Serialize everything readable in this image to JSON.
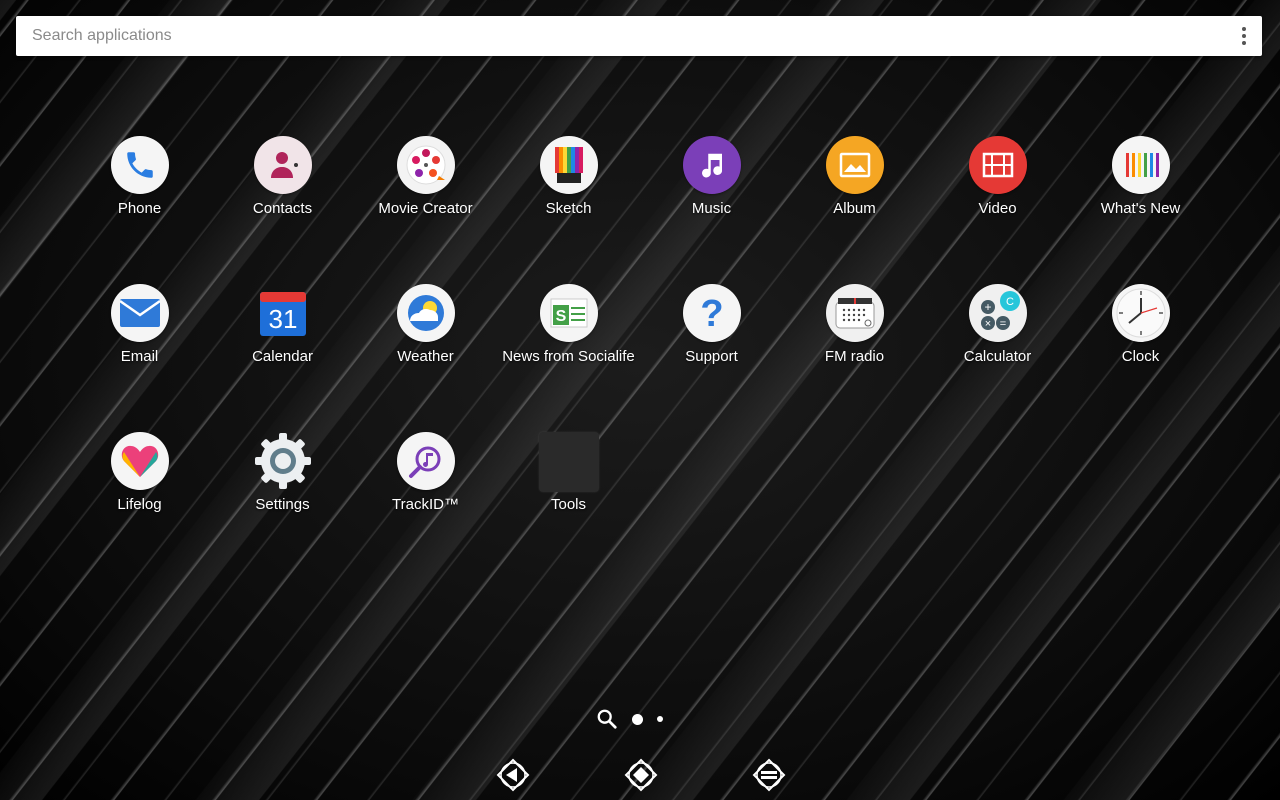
{
  "search": {
    "placeholder": "Search applications"
  },
  "apps": [
    {
      "label": "Phone",
      "icon": "phone-icon"
    },
    {
      "label": "Contacts",
      "icon": "contacts-icon"
    },
    {
      "label": "Movie Creator",
      "icon": "movie-creator-icon"
    },
    {
      "label": "Sketch",
      "icon": "sketch-icon"
    },
    {
      "label": "Music",
      "icon": "music-icon"
    },
    {
      "label": "Album",
      "icon": "album-icon"
    },
    {
      "label": "Video",
      "icon": "video-icon"
    },
    {
      "label": "What's New",
      "icon": "whats-new-icon"
    },
    {
      "label": "Email",
      "icon": "email-icon"
    },
    {
      "label": "Calendar",
      "icon": "calendar-icon",
      "day": "31"
    },
    {
      "label": "Weather",
      "icon": "weather-icon"
    },
    {
      "label": "News from Socialife",
      "icon": "socialife-icon"
    },
    {
      "label": "Support",
      "icon": "support-icon"
    },
    {
      "label": "FM radio",
      "icon": "fm-radio-icon"
    },
    {
      "label": "Calculator",
      "icon": "calculator-icon"
    },
    {
      "label": "Clock",
      "icon": "clock-icon"
    },
    {
      "label": "Lifelog",
      "icon": "lifelog-icon"
    },
    {
      "label": "Settings",
      "icon": "settings-icon"
    },
    {
      "label": "TrackID™",
      "icon": "trackid-icon"
    },
    {
      "label": "Tools",
      "icon": "folder-icon"
    }
  ],
  "pager": {
    "pages": 2,
    "current": 1
  },
  "navbar": [
    "back-icon",
    "home-icon",
    "recents-icon"
  ],
  "colors": {
    "music": "#7b3fb8",
    "album": "#f5a623",
    "video": "#e53935",
    "calendar": "#1e6fd9",
    "email": "#2f7ad8",
    "phone": "#2a7de1"
  }
}
